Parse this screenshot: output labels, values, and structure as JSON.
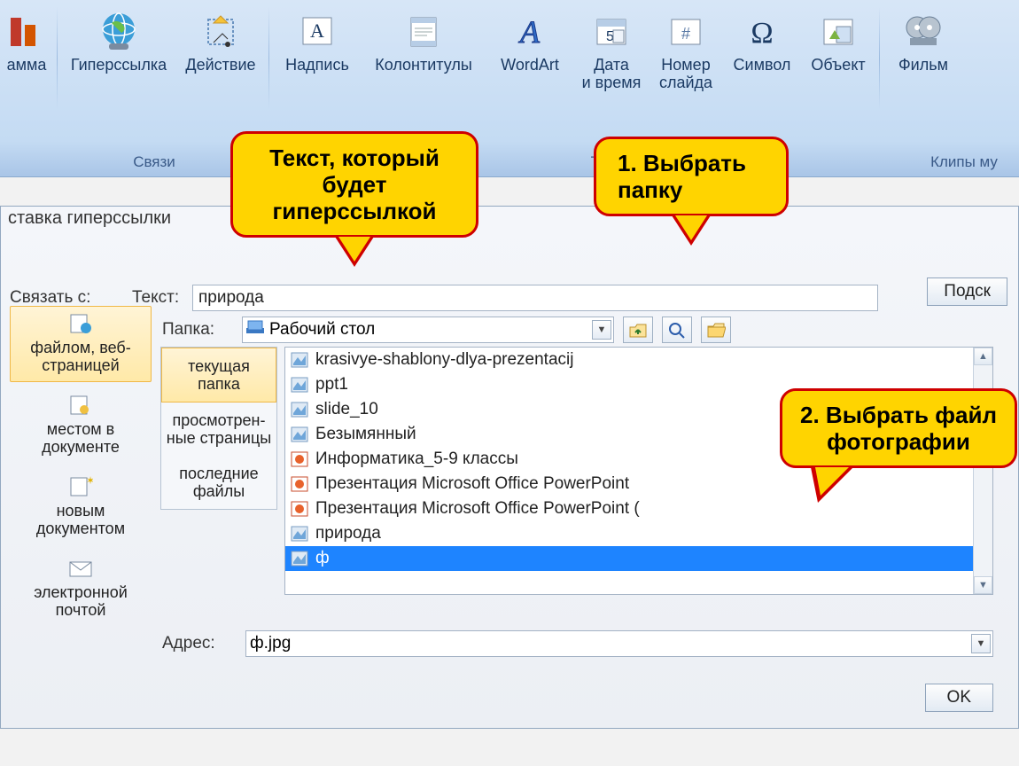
{
  "ribbon": {
    "items": [
      {
        "label": "амма",
        "icon": "chart-icon"
      },
      {
        "label": "Гиперссылка",
        "icon": "globe-icon"
      },
      {
        "label": "Действие",
        "icon": "action-icon"
      },
      {
        "label": "Надпись",
        "icon": "textbox-icon"
      },
      {
        "label": "Колонтитулы",
        "icon": "header-footer-icon"
      },
      {
        "label": "WordArt",
        "icon": "wordart-icon"
      },
      {
        "label": "Дата и время",
        "icon": "date-icon"
      },
      {
        "label": "Номер слайда",
        "icon": "slide-number-icon"
      },
      {
        "label": "Символ",
        "icon": "symbol-icon"
      },
      {
        "label": "Объект",
        "icon": "object-icon"
      },
      {
        "label": "Фильм",
        "icon": "film-icon"
      }
    ],
    "groups": {
      "links": "Связи",
      "text": "Текст",
      "media": "Клипы му"
    }
  },
  "dialog": {
    "title": "ставка гиперссылки",
    "link_with_label": "Связать с:",
    "text_label": "Текст:",
    "text_value": "природа",
    "hint_button": "Подск",
    "folder_label": "Папка:",
    "folder_value": "Рабочий стол",
    "address_label": "Адрес:",
    "address_value": "ф.jpg",
    "ok_button": "OK",
    "sidebar": [
      {
        "label": "файлом, веб-страницей",
        "icon": "file-web-icon",
        "active": true
      },
      {
        "label": "местом в документе",
        "icon": "place-doc-icon",
        "active": false
      },
      {
        "label": "новым документом",
        "icon": "new-doc-icon",
        "active": false
      },
      {
        "label": "электронной почтой",
        "icon": "email-icon",
        "active": false
      }
    ],
    "midbar": [
      {
        "label": "текущая папка",
        "active": true
      },
      {
        "label": "просмотрен-\nные страницы",
        "active": false
      },
      {
        "label": "последние файлы",
        "active": false
      }
    ],
    "files": [
      {
        "name": "krasivye-shablony-dlya-prezentacij",
        "icon": "img-file-icon",
        "selected": false
      },
      {
        "name": "ppt1",
        "icon": "img-file-icon",
        "selected": false
      },
      {
        "name": "slide_10",
        "icon": "img-file-icon",
        "selected": false
      },
      {
        "name": "Безымянный",
        "icon": "img-file-icon",
        "selected": false
      },
      {
        "name": "Информатика_5-9 классы",
        "icon": "ppt-file-icon",
        "selected": false
      },
      {
        "name": "Презентация Microsoft Office PowerPoint",
        "icon": "ppt-file-icon",
        "selected": false
      },
      {
        "name": "Презентация Microsoft Office PowerPoint (",
        "icon": "ppt-file-icon",
        "selected": false
      },
      {
        "name": "природа",
        "icon": "img-file-icon",
        "selected": false
      },
      {
        "name": "ф",
        "icon": "img-file-icon",
        "selected": true
      }
    ],
    "toolbar_icons": {
      "up": "up-folder-icon",
      "search": "search-web-icon",
      "open": "open-folder-icon"
    }
  },
  "callouts": {
    "a": "Текст, который будет гиперссылкой",
    "b": "1. Выбрать папку",
    "c": "2. Выбрать файл фотографии"
  }
}
